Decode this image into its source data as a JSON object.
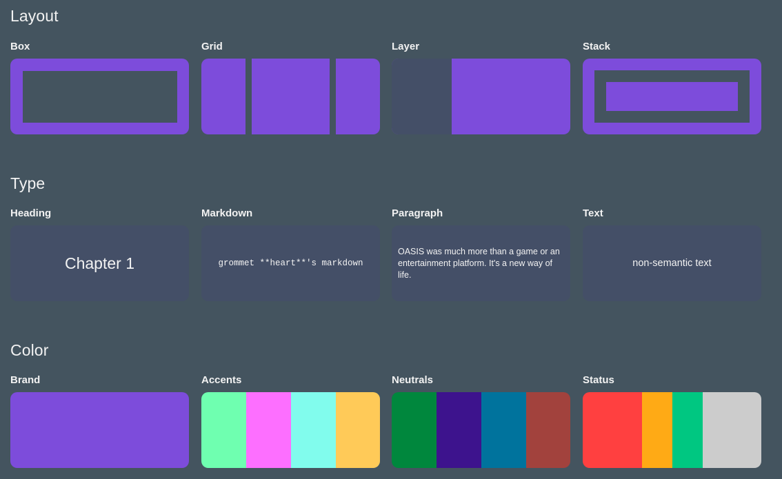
{
  "sections": {
    "layout": "Layout",
    "type": "Type",
    "color": "Color"
  },
  "layout_cards": {
    "box": "Box",
    "grid": "Grid",
    "layer": "Layer",
    "stack": "Stack"
  },
  "type_cards": {
    "heading": {
      "label": "Heading",
      "sample": "Chapter 1"
    },
    "markdown": {
      "label": "Markdown",
      "sample": "grommet **heart**'s markdown"
    },
    "paragraph": {
      "label": "Paragraph",
      "sample": "OASIS was much more than a game or an entertainment platform. It's a new way of life."
    },
    "text": {
      "label": "Text",
      "sample": "non-semantic text"
    }
  },
  "color_cards": {
    "brand": {
      "label": "Brand",
      "colors": [
        "#7d4cdb"
      ]
    },
    "accents": {
      "label": "Accents",
      "colors": [
        "#6fffb0",
        "#fd6fff",
        "#81fced",
        "#ffca58"
      ]
    },
    "neutrals": {
      "label": "Neutrals",
      "colors": [
        "#00873d",
        "#3d138d",
        "#00739d",
        "#a2423d"
      ]
    },
    "status": {
      "label": "Status",
      "colors": [
        "#ff4040",
        "#ffaa15",
        "#00c781",
        "#cccccc"
      ]
    }
  },
  "theme": {
    "background": "#44545f",
    "brand": "#7d4cdb",
    "panel": "#444f67"
  }
}
